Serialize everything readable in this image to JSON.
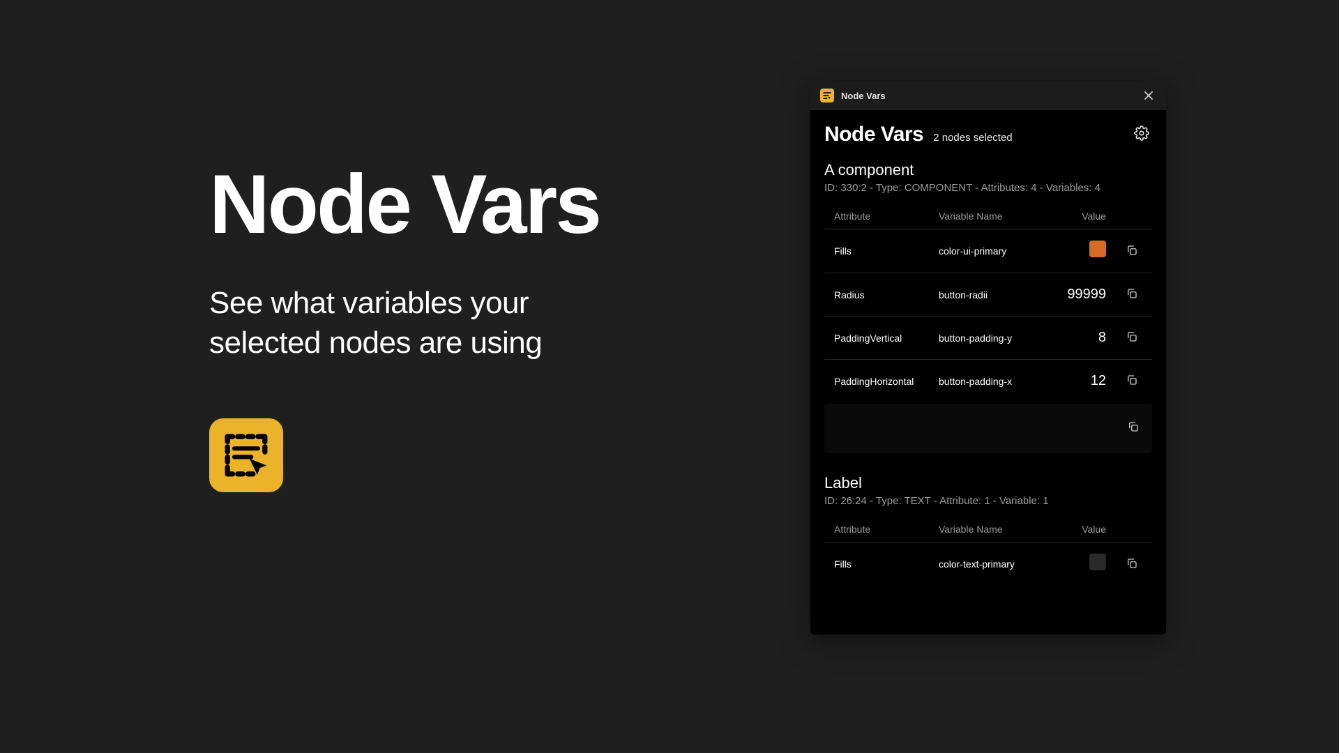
{
  "hero": {
    "title": "Node Vars",
    "subtitle_l1": "See what variables your",
    "subtitle_l2": "selected nodes are using"
  },
  "panel": {
    "titlebar": "Node Vars",
    "heading": "Node Vars",
    "selection": "2 nodes selected"
  },
  "colors": {
    "swatch_primary": "#d96a23",
    "swatch_text": "#2a2a2a",
    "logo_bg": "#eab32a"
  },
  "columns": {
    "attribute": "Attribute",
    "varname": "Variable Name",
    "value": "Value"
  },
  "nodes": [
    {
      "title": "A component",
      "meta": "ID: 330:2 - Type: COMPONENT - Attributes: 4 - Variables: 4",
      "rows": [
        {
          "attr": "Fills",
          "var": "color-ui-primary",
          "value": "",
          "swatch": "#d96a23"
        },
        {
          "attr": "Radius",
          "var": "button-radii",
          "value": "99999"
        },
        {
          "attr": "PaddingVertical",
          "var": "button-padding-y",
          "value": "8"
        },
        {
          "attr": "PaddingHorizontal",
          "var": "button-padding-x",
          "value": "12"
        }
      ]
    },
    {
      "title": "Label",
      "meta": "ID: 26:24 - Type: TEXT - Attribute: 1 - Variable: 1",
      "rows": [
        {
          "attr": "Fills",
          "var": "color-text-primary",
          "value": "",
          "swatch": "#2a2a2a"
        }
      ]
    }
  ]
}
